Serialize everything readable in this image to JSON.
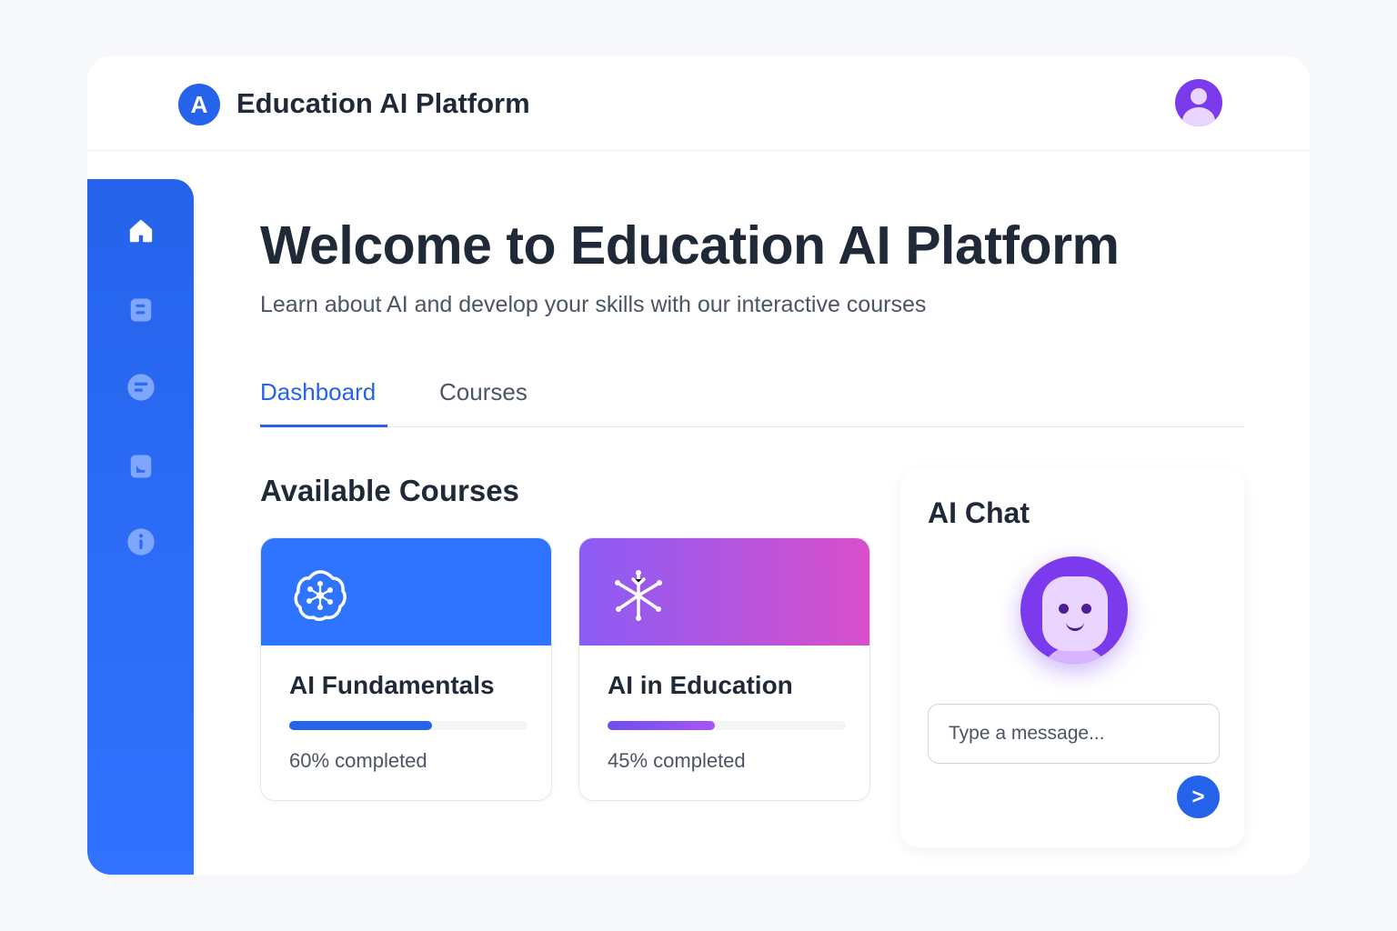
{
  "header": {
    "logo_letter": "A",
    "app_title": "Education AI Platform"
  },
  "sidebar": {
    "items": [
      {
        "icon": "home-icon",
        "active": true
      },
      {
        "icon": "book-icon",
        "active": false
      },
      {
        "icon": "chat-icon",
        "active": false
      },
      {
        "icon": "bookmark-icon",
        "active": false
      },
      {
        "icon": "info-icon",
        "active": false
      }
    ]
  },
  "main": {
    "welcome_title": "Welcome to Education AI Platform",
    "subtitle": "Learn about AI and develop your skills with our interactive courses",
    "tabs": [
      {
        "label": "Dashboard",
        "active": true
      },
      {
        "label": "Courses",
        "active": false
      }
    ],
    "section_title": "Available Courses",
    "courses": [
      {
        "title": "AI Fundamentals",
        "progress": 60,
        "progress_text": "60% completed",
        "icon": "brain-icon",
        "color": "#2f74ff"
      },
      {
        "title": "AI in Education",
        "progress": 45,
        "progress_text": "45% completed",
        "icon": "network-icon",
        "color": "#8b5cf6"
      }
    ]
  },
  "chat": {
    "title": "AI Chat",
    "input_placeholder": "Type a message...",
    "send_label": ">"
  },
  "colors": {
    "accent": "#2563eb",
    "purple": "#7c3aed",
    "pink": "#d84fc9"
  }
}
